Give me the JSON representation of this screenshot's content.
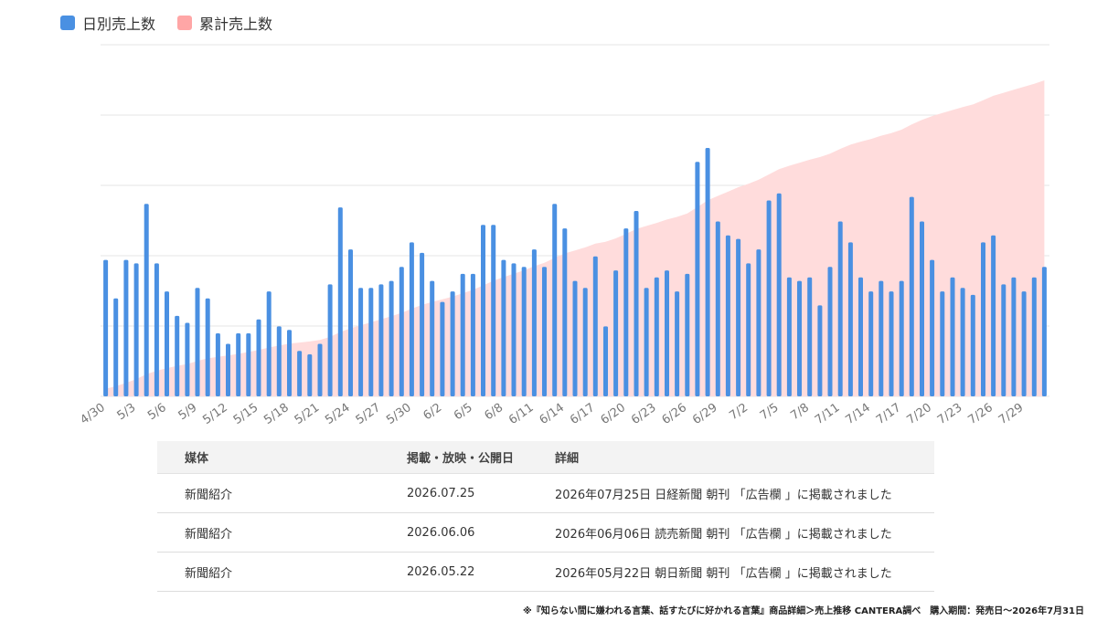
{
  "legend": [
    {
      "label": "日別売上数",
      "color": "#4a90e2"
    },
    {
      "label": "累計売上数",
      "color": "#ffa6a6"
    }
  ],
  "colors": {
    "bar": "#4a90e2",
    "area": "#ffdcdc",
    "grid": "#e6e6e6",
    "tick": "#777777"
  },
  "chart_data": {
    "type": "bar",
    "grid": true,
    "legend_position": "top-left",
    "categories": [
      "4/30",
      "5/1",
      "5/2",
      "5/3",
      "5/4",
      "5/5",
      "5/6",
      "5/7",
      "5/8",
      "5/9",
      "5/10",
      "5/11",
      "5/12",
      "5/13",
      "5/14",
      "5/15",
      "5/16",
      "5/17",
      "5/18",
      "5/19",
      "5/20",
      "5/21",
      "5/22",
      "5/23",
      "5/24",
      "5/25",
      "5/26",
      "5/27",
      "5/28",
      "5/29",
      "5/30",
      "5/31",
      "6/1",
      "6/2",
      "6/3",
      "6/4",
      "6/5",
      "6/6",
      "6/7",
      "6/8",
      "6/9",
      "6/10",
      "6/11",
      "6/12",
      "6/13",
      "6/14",
      "6/15",
      "6/16",
      "6/17",
      "6/18",
      "6/19",
      "6/20",
      "6/21",
      "6/22",
      "6/23",
      "6/24",
      "6/25",
      "6/26",
      "6/27",
      "6/28",
      "6/29",
      "6/30",
      "7/1",
      "7/2",
      "7/3",
      "7/4",
      "7/5",
      "7/6",
      "7/7",
      "7/8",
      "7/9",
      "7/10",
      "7/11",
      "7/12",
      "7/13",
      "7/14",
      "7/15",
      "7/16",
      "7/17",
      "7/18",
      "7/19",
      "7/20",
      "7/21",
      "7/22",
      "7/23",
      "7/24",
      "7/25",
      "7/26",
      "7/27",
      "7/28",
      "7/29",
      "7/30",
      "7/31"
    ],
    "tick_labels": [
      "4/30",
      "5/3",
      "5/6",
      "5/9",
      "5/12",
      "5/15",
      "5/18",
      "5/21",
      "5/24",
      "5/27",
      "5/30",
      "6/2",
      "6/5",
      "6/8",
      "6/11",
      "6/14",
      "6/17",
      "6/20",
      "6/23",
      "6/26",
      "6/29",
      "7/2",
      "7/5",
      "7/8",
      "7/11",
      "7/14",
      "7/17",
      "7/20",
      "7/23",
      "7/26",
      "7/29"
    ],
    "series": [
      {
        "name": "日別売上数",
        "type": "bar",
        "values": [
          39,
          28,
          39,
          38,
          55,
          38,
          30,
          23,
          21,
          31,
          28,
          18,
          15,
          18,
          18,
          22,
          30,
          20,
          19,
          13,
          12,
          15,
          32,
          54,
          42,
          31,
          31,
          32,
          33,
          37,
          44,
          41,
          33,
          27,
          30,
          35,
          35,
          49,
          49,
          39,
          38,
          37,
          42,
          37,
          55,
          48,
          33,
          31,
          40,
          20,
          36,
          48,
          53,
          31,
          34,
          36,
          30,
          35,
          67,
          71,
          50,
          46,
          45,
          38,
          42,
          56,
          58,
          34,
          33,
          34,
          26,
          37,
          50,
          44,
          34,
          30,
          33,
          30,
          33,
          57,
          50,
          39,
          30,
          34,
          31,
          29,
          44,
          46,
          32,
          34,
          30,
          34,
          37
        ]
      },
      {
        "name": "累計売上数",
        "type": "area",
        "values": [
          2,
          2.7,
          3.6,
          4.6,
          5.9,
          6.8,
          7.5,
          8.1,
          8.6,
          9.4,
          10.1,
          10.5,
          10.9,
          11.3,
          11.8,
          12.3,
          13,
          13.5,
          14,
          14.3,
          14.6,
          15,
          15.8,
          17.1,
          18.1,
          18.9,
          19.7,
          20.5,
          21.3,
          22.2,
          23.3,
          24.3,
          25.1,
          25.8,
          26.5,
          27.4,
          28.3,
          29.5,
          30.7,
          31.7,
          32.6,
          33.5,
          34.6,
          35.5,
          36.8,
          38,
          38.8,
          39.6,
          40.6,
          41.1,
          42,
          43.2,
          44.5,
          45.3,
          46.1,
          47,
          47.7,
          48.6,
          50.3,
          52.1,
          53.3,
          54.4,
          55.6,
          56.5,
          57.6,
          59,
          60.4,
          61.3,
          62.1,
          62.9,
          63.6,
          64.5,
          65.8,
          66.9,
          67.7,
          68.4,
          69.3,
          70,
          70.9,
          72.3,
          73.5,
          74.5,
          75.3,
          76.1,
          76.9,
          77.6,
          78.7,
          79.9,
          80.7,
          81.5,
          82.3,
          83.1,
          84
        ]
      }
    ]
  },
  "table": {
    "headers": [
      "媒体",
      "掲載・放映・公開日",
      "詳細"
    ],
    "rows": [
      [
        "新聞紹介",
        "2026.07.25",
        "2026年07月25日 日経新聞 朝刊 「広告欄 」に掲載されました"
      ],
      [
        "新聞紹介",
        "2026.06.06",
        "2026年06月06日 読売新聞 朝刊 「広告欄 」に掲載されました"
      ],
      [
        "新聞紹介",
        "2026.05.22",
        "2026年05月22日 朝日新聞 朝刊 「広告欄 」に掲載されました"
      ]
    ]
  },
  "footnote": "※『知らない間に嫌われる言葉、話すたびに好かれる言葉』商品詳細＞売上推移 CANTERA調べ　購入期間：発売日〜2026年7月31日"
}
